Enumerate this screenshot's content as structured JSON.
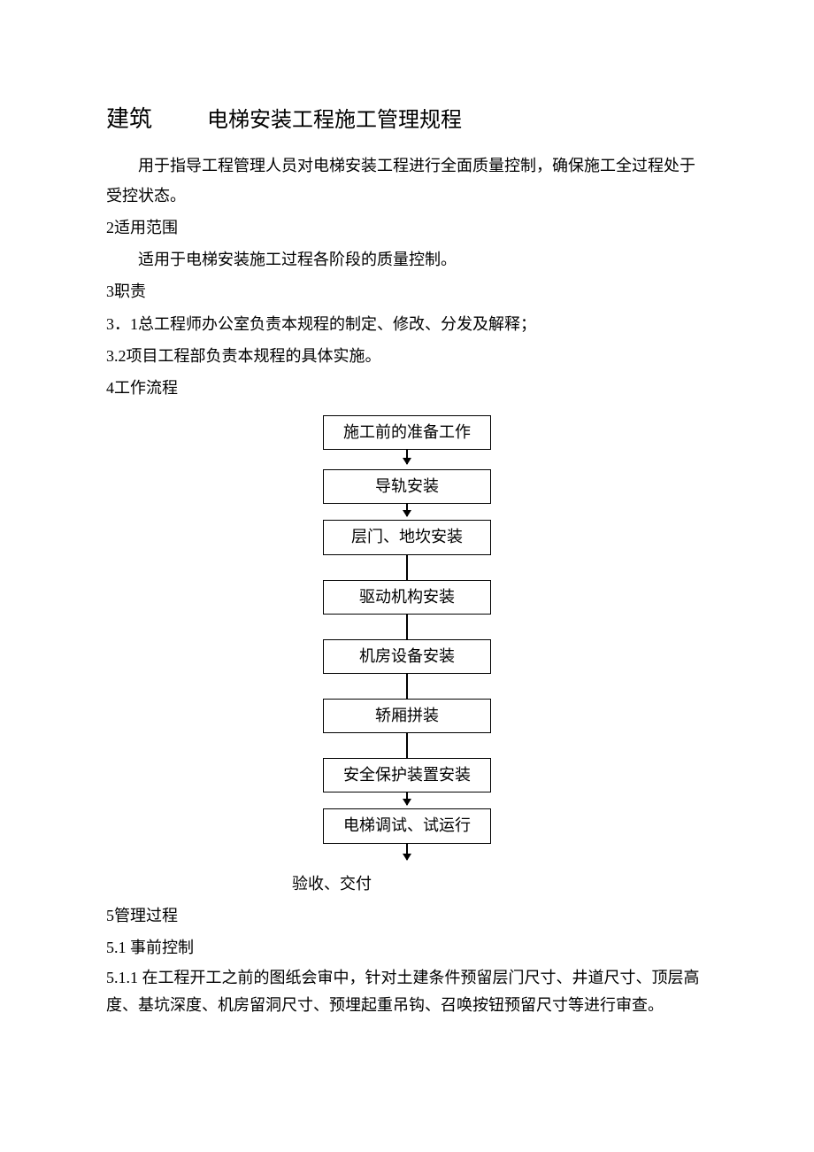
{
  "title": {
    "left": "建筑",
    "right": "电梯安装工程施工管理规程"
  },
  "intro": "用于指导工程管理人员对电梯安装工程进行全面质量控制，确保施工全过程处于受控状态。",
  "sec2": {
    "heading": "2适用范围",
    "body": "适用于电梯安装施工过程各阶段的质量控制。"
  },
  "sec3": {
    "heading": "3职责",
    "item1": "3．1总工程师办公室负责本规程的制定、修改、分发及解释；",
    "item2": "3.2项目工程部负责本规程的具体实施。"
  },
  "sec4": {
    "heading": "4工作流程"
  },
  "flow": {
    "s1": "施工前的准备工作",
    "s2": "导轨安装",
    "s3": "层门、地坎安装",
    "s4": "驱动机构安装",
    "s5": "机房设备安装",
    "s6": "轿厢拼装",
    "s7": "安全保护装置安装",
    "s8": "电梯调试、试运行",
    "final": "验收、交付"
  },
  "sec5": {
    "heading": "5管理过程",
    "sub1": "5.1 事前控制",
    "sub1_1": "5.1.1 在工程开工之前的图纸会审中，针对土建条件预留层门尺寸、井道尺寸、顶层高度、基坑深度、机房留洞尺寸、预埋起重吊钩、召唤按钮预留尺寸等进行审查。"
  }
}
